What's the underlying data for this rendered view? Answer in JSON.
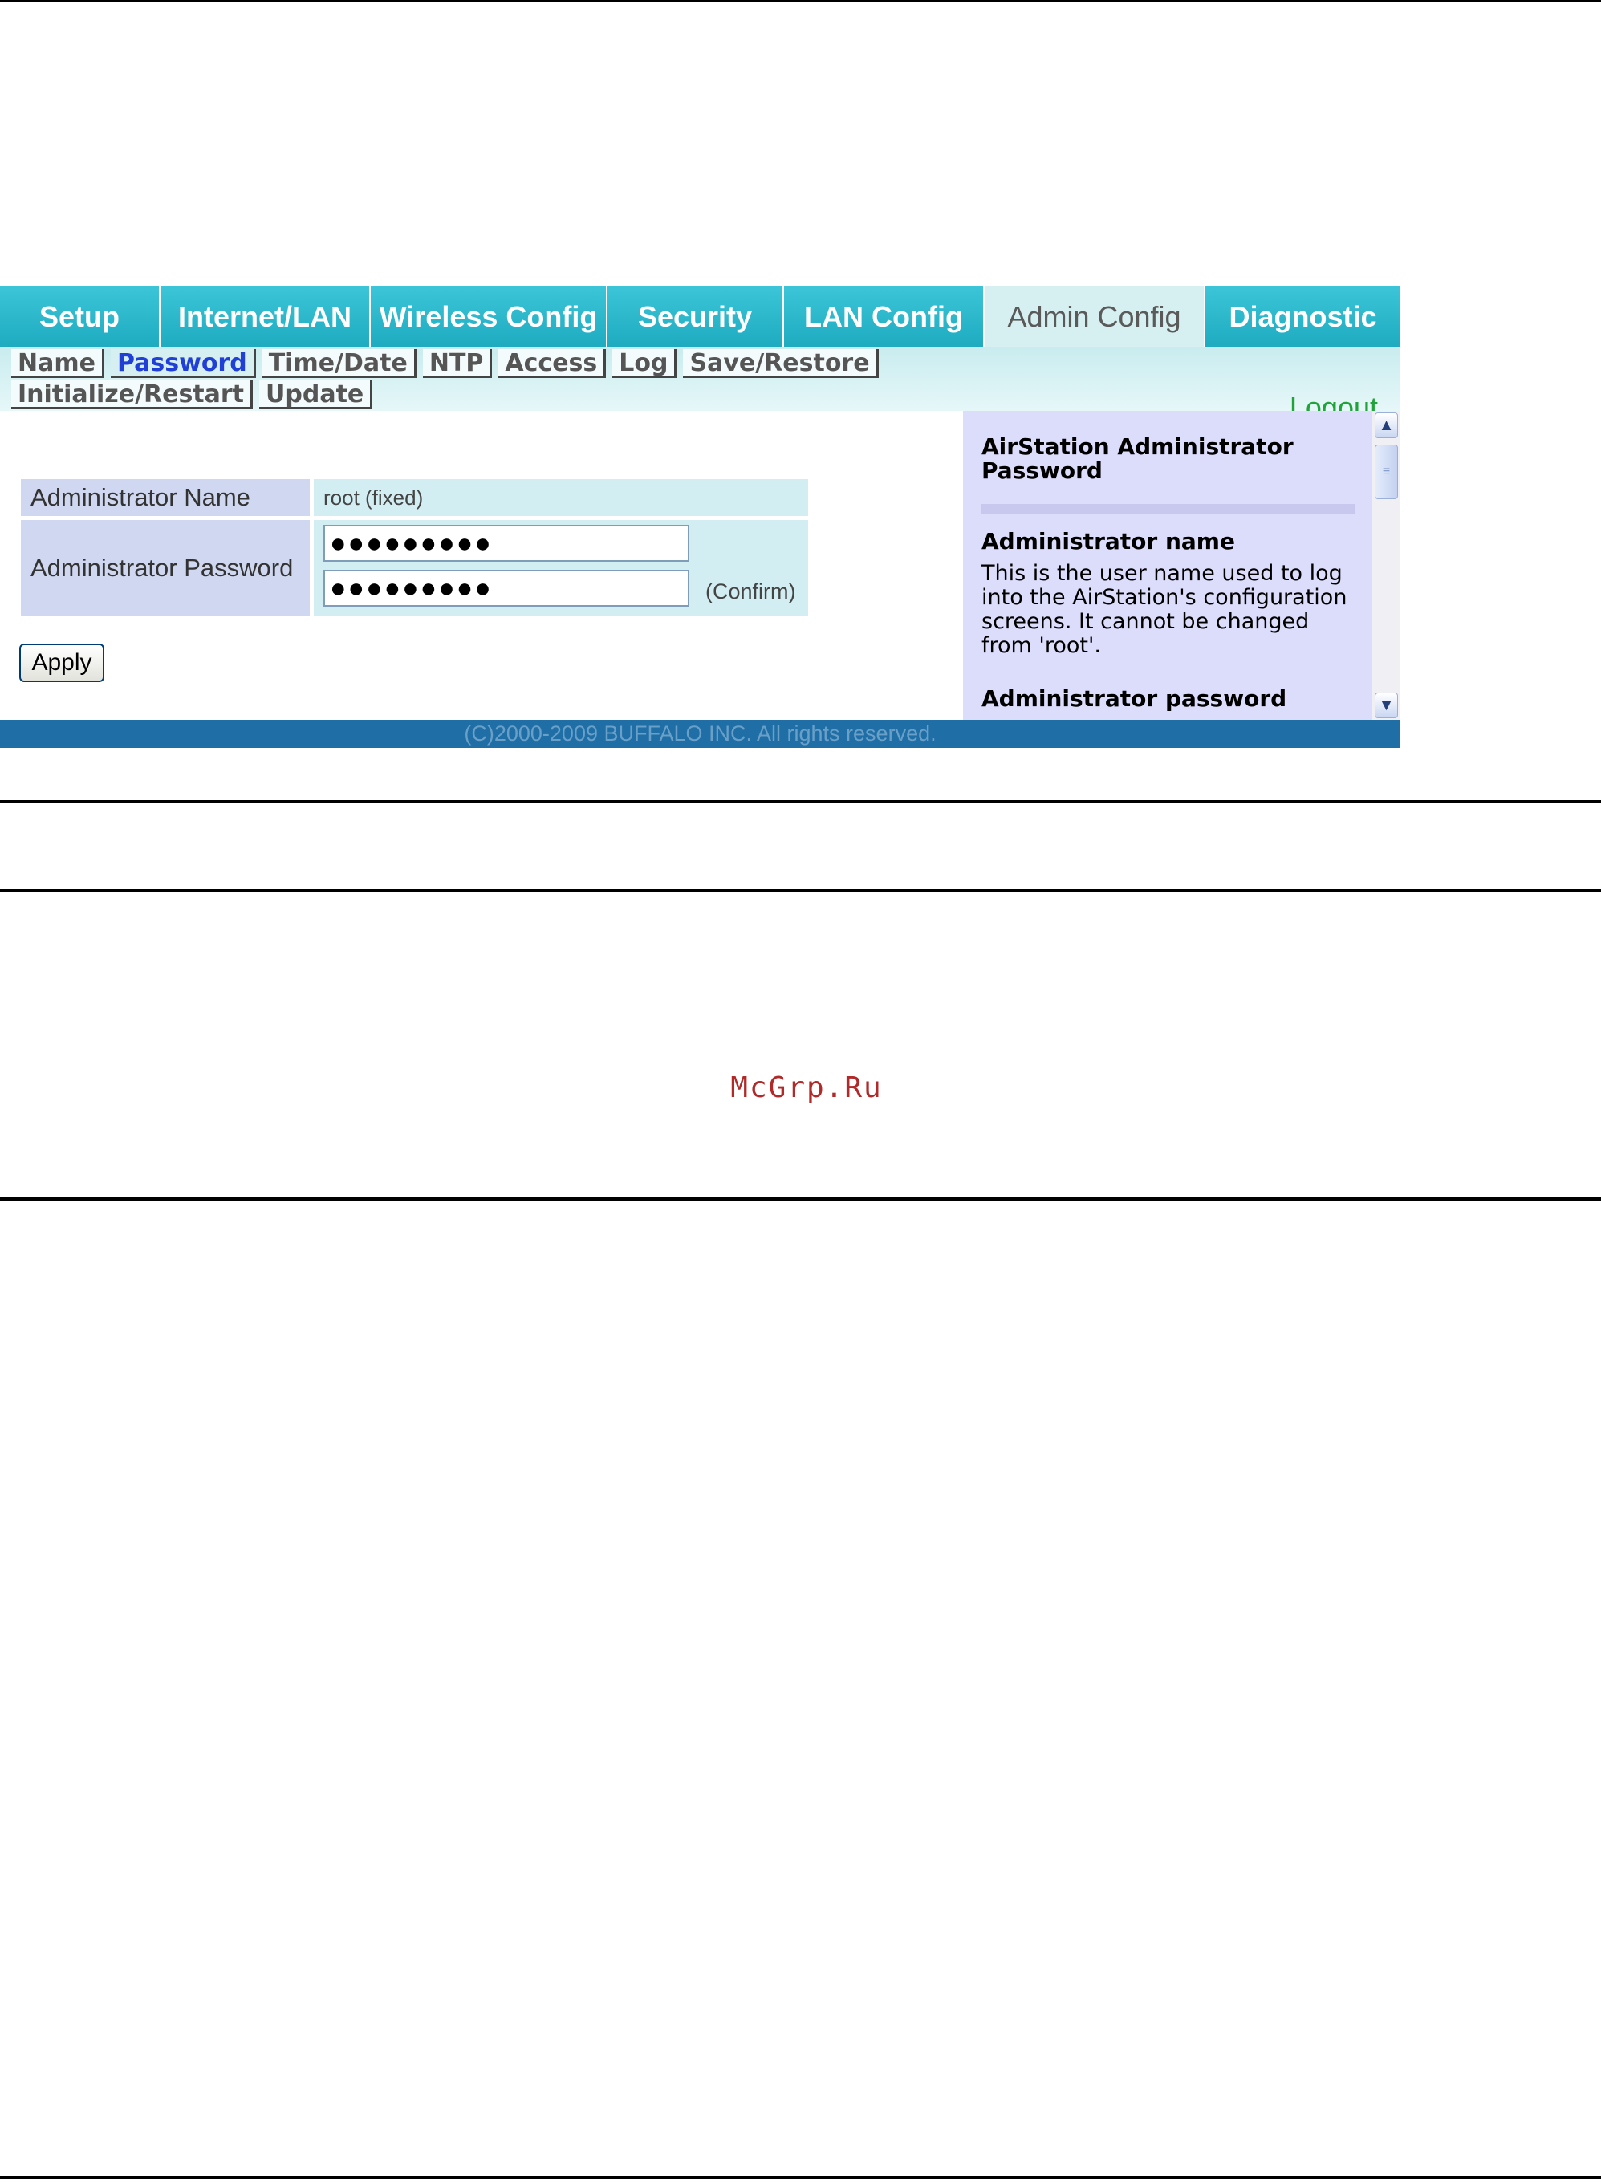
{
  "main_tabs": [
    "Setup",
    "Internet/LAN",
    "Wireless Config",
    "Security",
    "LAN Config",
    "Admin Config",
    "Diagnostic"
  ],
  "active_main_tab": "Admin Config",
  "sub_nav_row1": [
    "Name",
    "Password",
    "Time/Date",
    "NTP",
    "Access",
    "Log",
    "Save/Restore"
  ],
  "sub_nav_row2": [
    "Initialize/Restart",
    "Update"
  ],
  "active_sub_tab": "Password",
  "logout_label": "Logout",
  "form": {
    "admin_name_label": "Administrator Name",
    "admin_name_value": "root (fixed)",
    "admin_password_label": "Administrator Password",
    "password_mask": "●●●●●●●●●",
    "confirm_password_mask": "●●●●●●●●●",
    "confirm_label": "(Confirm)",
    "apply_label": "Apply"
  },
  "help": {
    "title": "AirStation Administrator Password",
    "section1_heading": "Administrator name",
    "section1_text": "This is the user name used to log into the AirStation's configuration screens. It cannot be changed from 'root'.",
    "section2_heading": "Administrator password"
  },
  "footer_text": "(C)2000-2009 BUFFALO INC. All rights reserved.",
  "watermark": "McGrp.Ru",
  "colors": {
    "tab_bar": "#2ab5c9",
    "active_tab_bg": "#d6f0f2",
    "footer_bg": "#1f6fa6",
    "logout": "#1fa33a",
    "active_sub_link": "#1f3fd6",
    "help_bg": "#dcdcfb"
  }
}
